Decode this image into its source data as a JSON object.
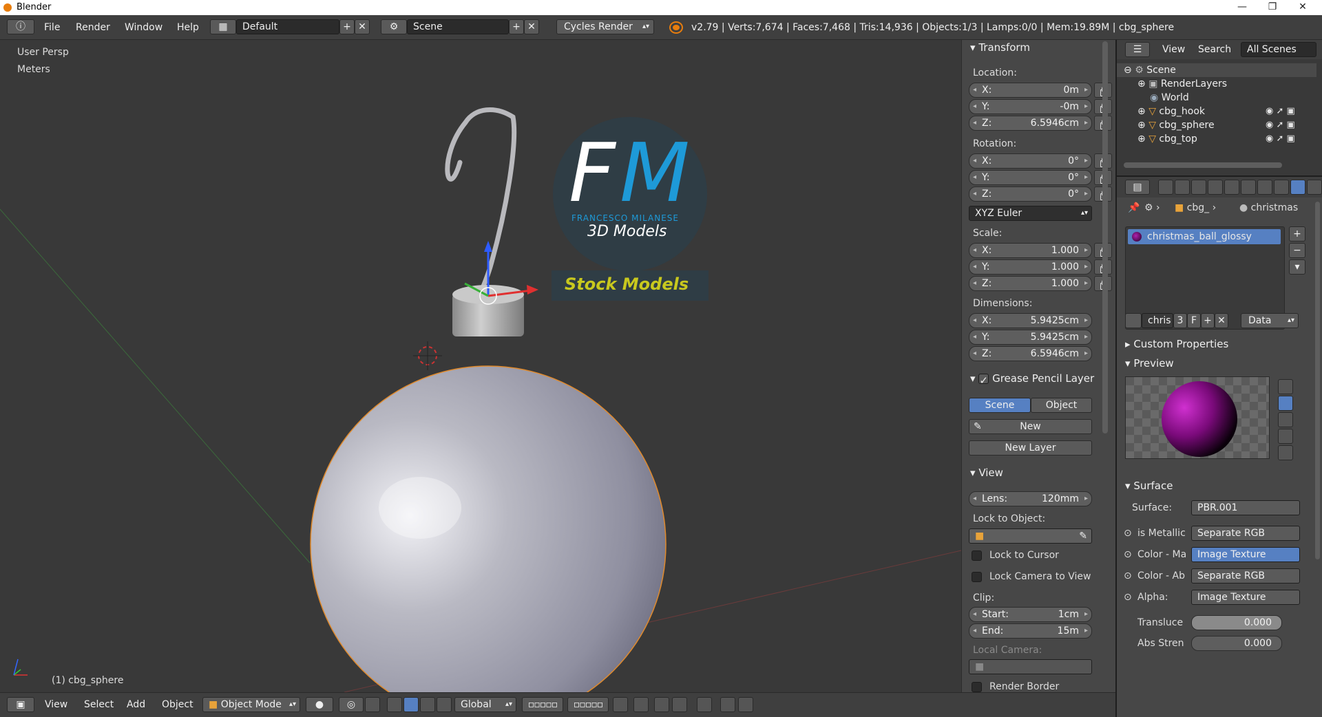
{
  "window": {
    "title": "Blender",
    "controls": [
      "—",
      "❐",
      "✕"
    ]
  },
  "menu": {
    "items": [
      "File",
      "Render",
      "Window",
      "Help"
    ],
    "screen_layout": "Default",
    "scene": "Scene",
    "engine": "Cycles Render",
    "stats": "v2.79 | Verts:7,674 | Faces:7,468 | Tris:14,936 | Objects:1/3 | Lamps:0/0 | Mem:19.89M | cbg_sphere"
  },
  "viewport": {
    "view_name": "User Persp",
    "units": "Meters",
    "active_object": "(1) cbg_sphere",
    "watermark": {
      "initials_f": "F",
      "initials_m": "M",
      "name": "FRANCESCO MILANESE",
      "subtitle": "3D Models",
      "banner": "Stock Models"
    }
  },
  "npanel": {
    "transform": {
      "header": "Transform",
      "location_label": "Location:",
      "location": [
        {
          "k": "X:",
          "v": "0m"
        },
        {
          "k": "Y:",
          "v": "-0m"
        },
        {
          "k": "Z:",
          "v": "6.5946cm"
        }
      ],
      "rotation_label": "Rotation:",
      "rotation": [
        {
          "k": "X:",
          "v": "0°"
        },
        {
          "k": "Y:",
          "v": "0°"
        },
        {
          "k": "Z:",
          "v": "0°"
        }
      ],
      "rotation_mode": "XYZ Euler",
      "scale_label": "Scale:",
      "scale": [
        {
          "k": "X:",
          "v": "1.000"
        },
        {
          "k": "Y:",
          "v": "1.000"
        },
        {
          "k": "Z:",
          "v": "1.000"
        }
      ],
      "dimensions_label": "Dimensions:",
      "dimensions": [
        {
          "k": "X:",
          "v": "5.9425cm"
        },
        {
          "k": "Y:",
          "v": "5.9425cm"
        },
        {
          "k": "Z:",
          "v": "6.5946cm"
        }
      ]
    },
    "grease_pencil": {
      "header": "Grease Pencil Layer",
      "scene_tab": "Scene",
      "object_tab": "Object",
      "new_label": "New",
      "new_layer_label": "New Layer"
    },
    "view": {
      "header": "View",
      "lens_key": "Lens:",
      "lens_value": "120mm",
      "lock_to_object_label": "Lock to Object:",
      "lock_to_cursor": "Lock to Cursor",
      "lock_camera_to_view": "Lock Camera to View",
      "clip_label": "Clip:",
      "clip_start_key": "Start:",
      "clip_start_value": "1cm",
      "clip_end_key": "End:",
      "clip_end_value": "15m",
      "local_camera_label": "Local Camera:",
      "render_border": "Render Border"
    }
  },
  "outliner": {
    "view_menu": "View",
    "search_menu": "Search",
    "filter": "All Scenes",
    "items": [
      {
        "label": "Scene"
      },
      {
        "label": "RenderLayers"
      },
      {
        "label": "World"
      },
      {
        "label": "cbg_hook"
      },
      {
        "label": "cbg_sphere"
      },
      {
        "label": "cbg_top"
      }
    ]
  },
  "properties": {
    "breadcrumb_object": "cbg_",
    "breadcrumb_material": "christmas",
    "material_slot": "christmas_ball_glossy",
    "material_name": "chris",
    "user_count": "3",
    "fake_user": "F",
    "link_mode": "Data",
    "custom_properties_header": "Custom Properties",
    "preview_header": "Preview",
    "surface_header": "Surface",
    "surface_label": "Surface:",
    "surface_value": "PBR.001",
    "inputs": [
      {
        "label": "is Metallic",
        "value": "Separate RGB",
        "highlight": false
      },
      {
        "label": "Color - Ma",
        "value": "Image Texture",
        "highlight": true
      },
      {
        "label": "Color - Ab",
        "value": "Separate RGB",
        "highlight": false
      },
      {
        "label": "Alpha:",
        "value": "Image Texture",
        "highlight": false
      }
    ],
    "translucency_label": "Transluce",
    "translucency_value": "0.000",
    "abs_strength_label": "Abs Stren",
    "abs_strength_value": "0.000"
  },
  "bottombar": {
    "menus": [
      "View",
      "Select",
      "Add",
      "Object"
    ],
    "mode": "Object Mode",
    "orientation": "Global"
  }
}
